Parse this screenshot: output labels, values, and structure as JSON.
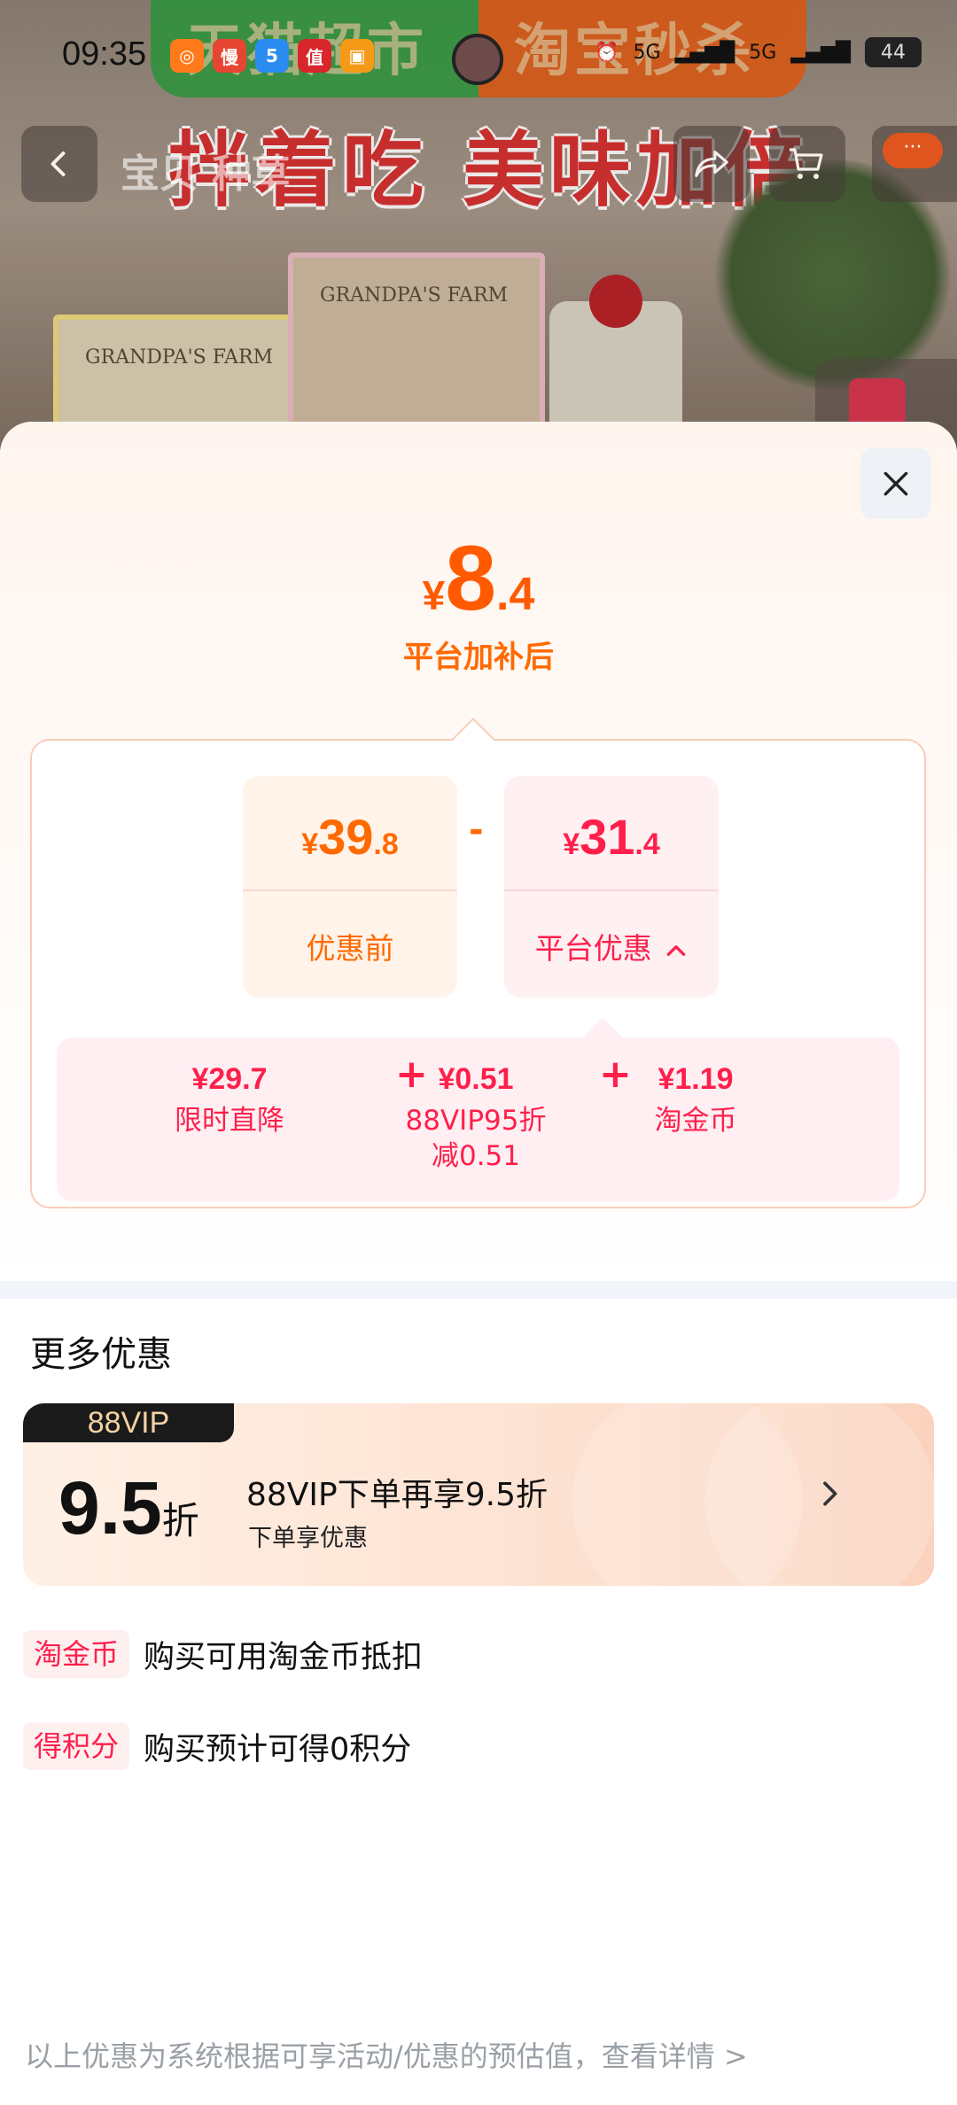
{
  "status_bar": {
    "time": "09:35",
    "network_1": "5G",
    "network_2": "5G",
    "battery": "44"
  },
  "background_page": {
    "banner_left": "天猫超市",
    "banner_right": "淘宝秒杀",
    "slogan": "拌着吃 美味加倍",
    "nav_title": "宝贝 种草",
    "more_label": "···"
  },
  "price_sheet": {
    "final_price": {
      "currency": "¥",
      "integer": "8",
      "decimal": ".4"
    },
    "final_label": "平台加补后",
    "before": {
      "currency": "¥",
      "integer": "39",
      "decimal": ".8",
      "label": "优惠前"
    },
    "operator": "-",
    "platform": {
      "currency": "¥",
      "integer": "31",
      "decimal": ".4",
      "label": "平台优惠"
    },
    "breakdown": [
      {
        "value": "¥29.7",
        "name": "限时直降",
        "sub": ""
      },
      {
        "value": "¥0.51",
        "name": "88VIP95折",
        "sub": "减0.51"
      },
      {
        "value": "¥1.19",
        "name": "淘金币",
        "sub": ""
      }
    ],
    "plus": "+"
  },
  "more_offers": {
    "title": "更多优惠",
    "vip": {
      "tag": "88VIP",
      "discount_number": "9.5",
      "discount_unit": "折",
      "main": "88VIP下单再享9.5折",
      "sub": "下单享优惠"
    },
    "rows": [
      {
        "tag": "淘金币",
        "text": "购买可用淘金币抵扣"
      },
      {
        "tag": "得积分",
        "text": "购买预计可得0积分"
      }
    ]
  },
  "footer_note": "以上优惠为系统根据可享活动/优惠的预估值，查看详情 >",
  "colors": {
    "orange": "#ff6a00",
    "red": "#ff1f4b",
    "vip_dark": "#1a1a1a"
  }
}
